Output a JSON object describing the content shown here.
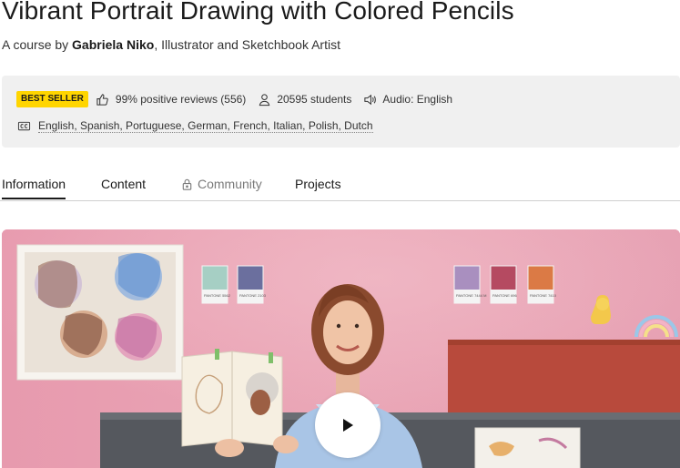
{
  "course": {
    "title": "Vibrant Portrait Drawing with Colored Pencils",
    "byline_prefix": "A course by ",
    "author": "Gabriela Niko",
    "author_suffix": ", Illustrator and Sketchbook Artist"
  },
  "info": {
    "badge": "BEST SELLER",
    "reviews": "99% positive reviews (556)",
    "students": "20595 students",
    "audio": "Audio: English",
    "subtitles": "English, Spanish, Portuguese, German, French, Italian, Polish, Dutch"
  },
  "tabs": [
    {
      "label": "Information"
    },
    {
      "label": "Content"
    },
    {
      "label": "Community"
    },
    {
      "label": "Projects"
    }
  ],
  "colors": {
    "badge": "#ffd500",
    "wall": "#e8a3b4",
    "panel": "#b84a3c"
  },
  "swatches": [
    {
      "label": "PANTONE 5562"
    },
    {
      "label": "PANTONE 2103"
    },
    {
      "label": "PANTONE 7444 M"
    },
    {
      "label": "PANTONE 696"
    },
    {
      "label": "PANTONE 7410"
    }
  ]
}
